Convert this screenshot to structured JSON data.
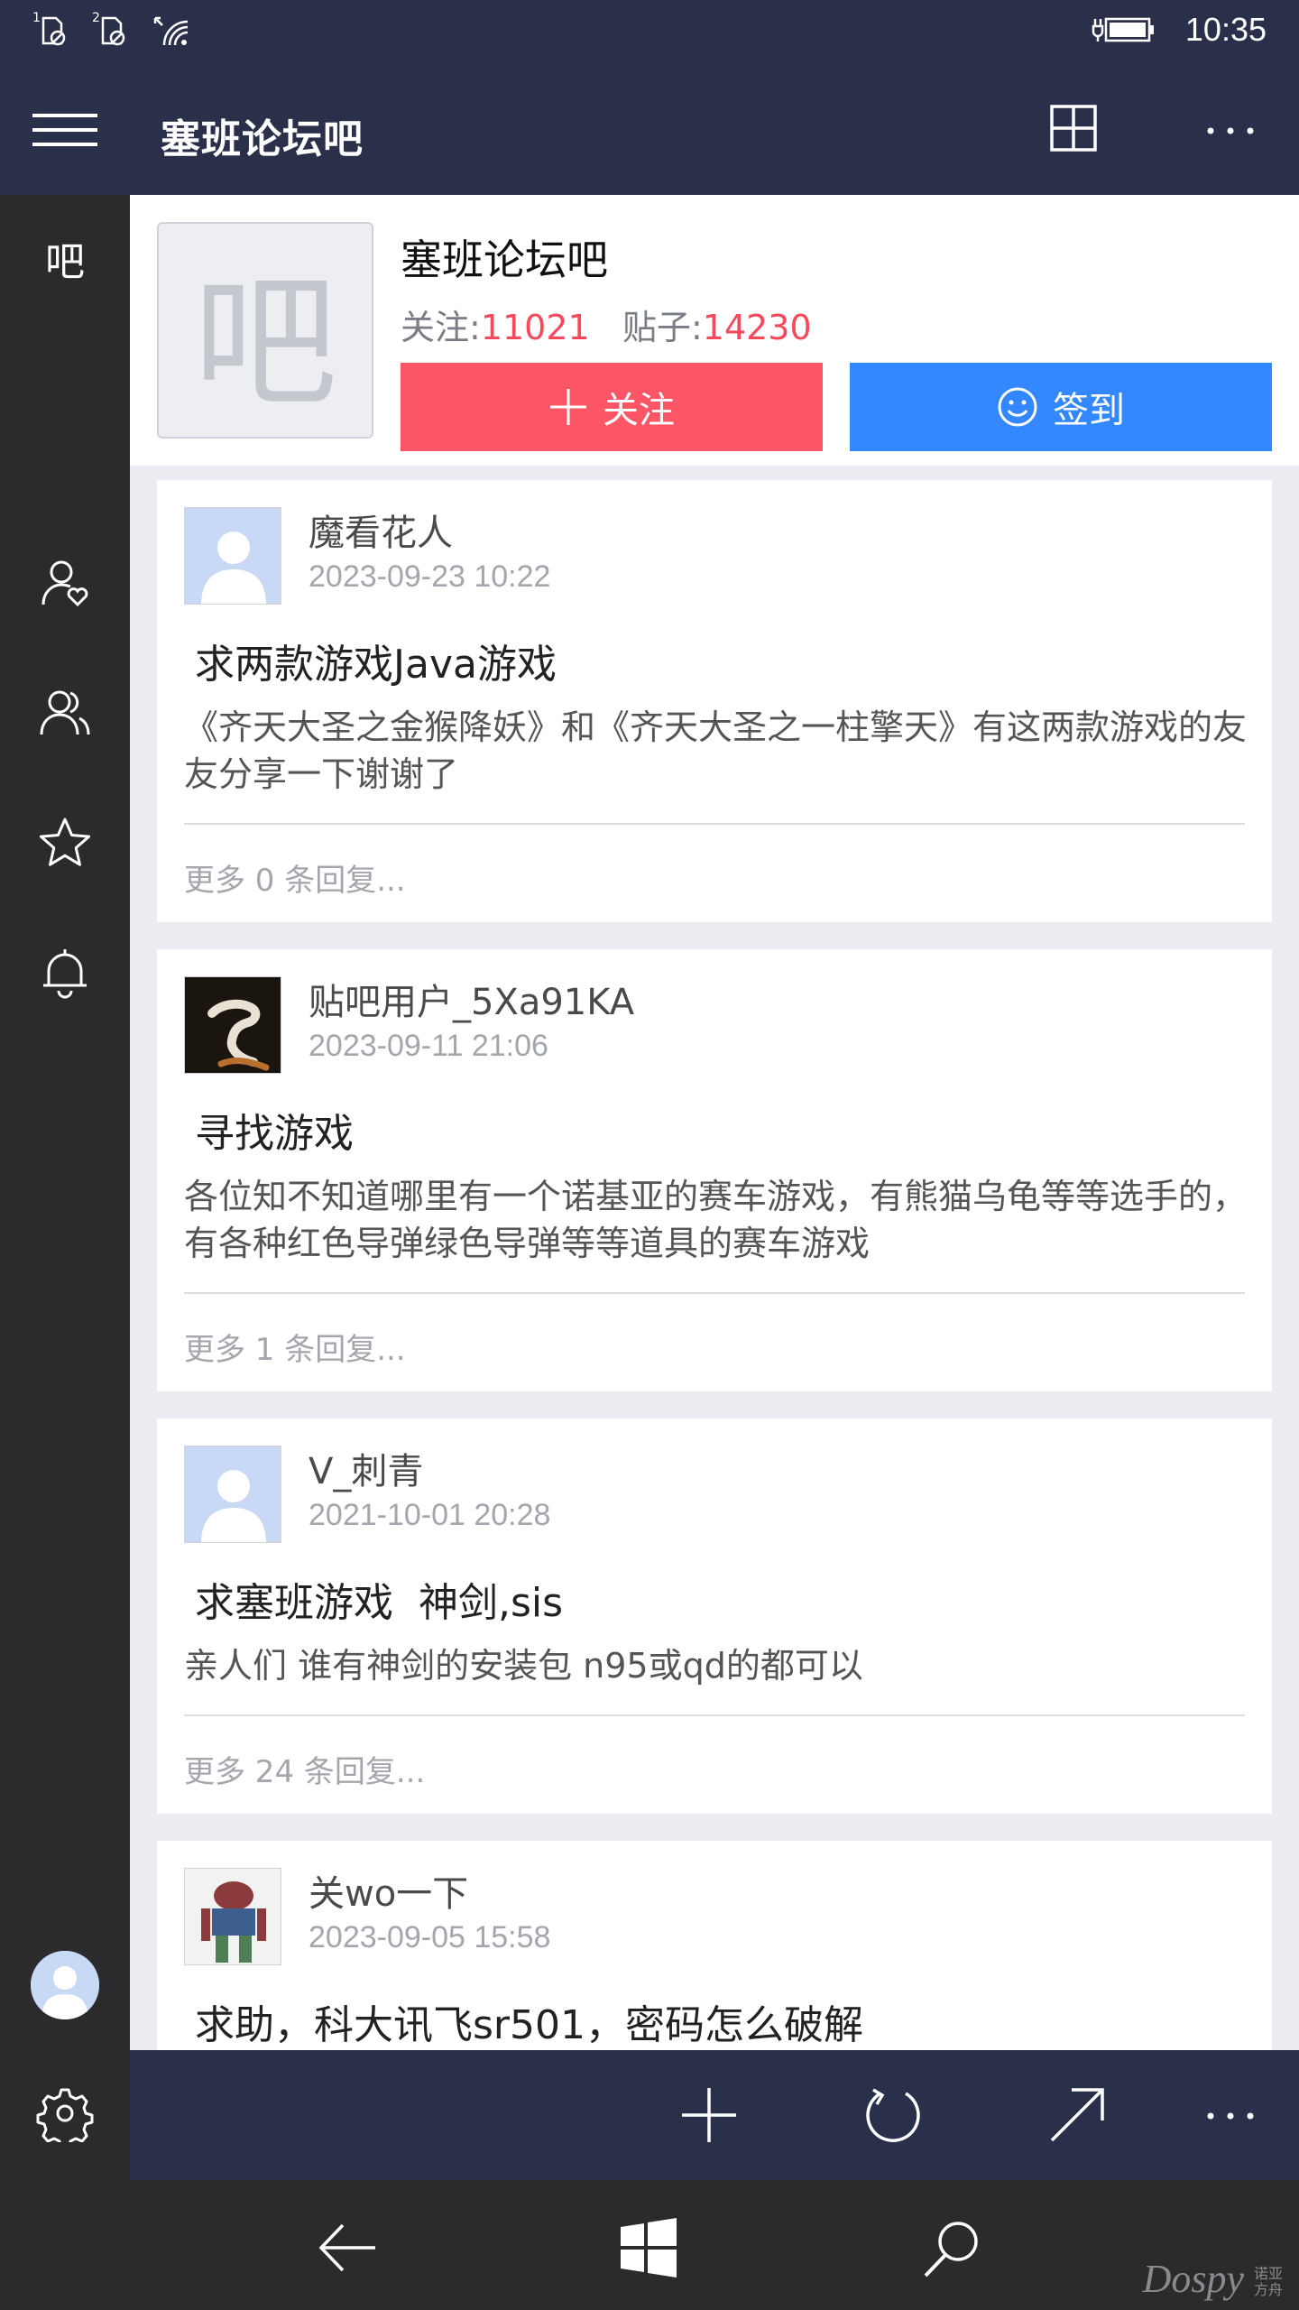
{
  "status_bar": {
    "sim1": "1",
    "sim2": "2",
    "time": "10:35"
  },
  "header": {
    "title": "塞班论坛吧"
  },
  "rail": {
    "ba_label": "吧"
  },
  "forum": {
    "logo_char": "吧",
    "name": "塞班论坛吧",
    "follow_label": "关注:",
    "follow_count": "11021",
    "posts_label": "贴子:",
    "posts_count": "14230",
    "follow_button": "关注",
    "sign_button": "签到"
  },
  "posts": [
    {
      "user": "魔看花人",
      "time": "2023-09-23 10:22",
      "title": "求两款游戏Java游戏",
      "body": "《齐天大圣之金猴降妖》和《齐天大圣之一柱擎天》有这两款游戏的友友分享一下谢谢了",
      "more": "更多 0 条回复..."
    },
    {
      "user": "贴吧用户_5Xa91KA",
      "time": "2023-09-11 21:06",
      "title": "寻找游戏",
      "body": "各位知不知道哪里有一个诺基亚的赛车游戏，有熊猫乌龟等等选手的，有各种红色导弹绿色导弹等等道具的赛车游戏",
      "more": "更多 1 条回复..."
    },
    {
      "user": "V_刺青",
      "time": "2021-10-01 20:28",
      "title": "求塞班游戏  神剑,sis",
      "body": "亲人们 谁有神剑的安装包 n95或qd的都可以",
      "more": "更多 24 条回复..."
    },
    {
      "user": "关wo一下",
      "time": "2023-09-05 15:58",
      "title": "求助，科大讯飞sr501，密码怎么破解"
    }
  ],
  "watermark": {
    "brand": "Dospy",
    "small": "诺亚方舟"
  },
  "colors": {
    "dark_bar": "#2a3049",
    "rail": "#2b2b2d",
    "follow": "#fb5566",
    "sign": "#3388ff",
    "count": "#f44a5c"
  }
}
